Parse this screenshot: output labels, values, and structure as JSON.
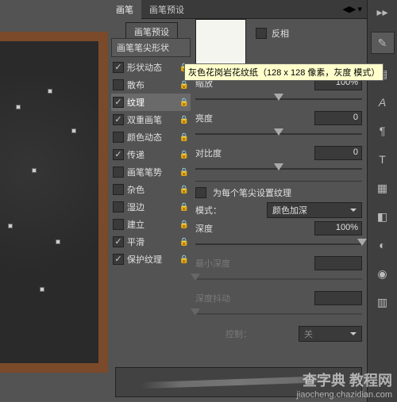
{
  "tabs": {
    "brush": "画笔",
    "preset": "画笔预设"
  },
  "preset_button": "画笔预设",
  "invert_label": "反相",
  "tooltip": "灰色花岗岩花纹纸（128 x 128 像素，灰度 模式）",
  "sections": {
    "tip_shape": "画笔笔尖形状"
  },
  "checklist": [
    {
      "label": "形状动态",
      "checked": true,
      "lock": true
    },
    {
      "label": "散布",
      "checked": false,
      "lock": true
    },
    {
      "label": "纹理",
      "checked": true,
      "lock": true,
      "selected": true
    },
    {
      "label": "双重画笔",
      "checked": true,
      "lock": true
    },
    {
      "label": "颜色动态",
      "checked": false,
      "lock": true
    },
    {
      "label": "传递",
      "checked": true,
      "lock": true
    },
    {
      "label": "画笔笔势",
      "checked": false,
      "lock": true
    },
    {
      "label": "杂色",
      "checked": false,
      "lock": true
    },
    {
      "label": "湿边",
      "checked": false,
      "lock": true
    },
    {
      "label": "建立",
      "checked": false,
      "lock": true
    },
    {
      "label": "平滑",
      "checked": true,
      "lock": true
    },
    {
      "label": "保护纹理",
      "checked": true,
      "lock": true
    }
  ],
  "controls": {
    "scale": {
      "label": "缩放",
      "value": "100%"
    },
    "brightness": {
      "label": "亮度",
      "value": "0"
    },
    "contrast": {
      "label": "对比度",
      "value": "0"
    },
    "per_tip": {
      "label": "为每个笔尖设置纹理",
      "checked": false
    },
    "mode": {
      "label": "模式：",
      "value": "颜色加深"
    },
    "depth": {
      "label": "深度",
      "value": "100%"
    },
    "min_depth": {
      "label": "最小深度"
    },
    "depth_jitter": {
      "label": "深度抖动"
    },
    "ctrl": {
      "label": "控制：",
      "value": "关"
    }
  },
  "watermark": {
    "line1": "查字典 教程网",
    "line2": "jiaocheng.chazidian.com"
  },
  "rail_icons": [
    "expand",
    "brush",
    "clip",
    "type-a",
    "para",
    "type-t",
    "swatch",
    "square",
    "layers1",
    "circle",
    "layers2"
  ]
}
